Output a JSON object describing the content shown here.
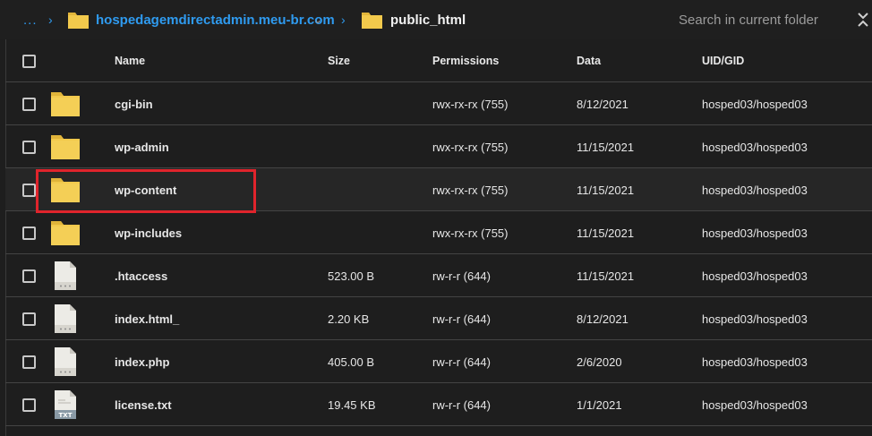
{
  "breadcrumb": {
    "ellipsis": "...",
    "sep": "›",
    "domain": "hospedagemdirectadmin.meu-br.com",
    "domain_caret": "⌄",
    "current": "public_html"
  },
  "search": {
    "placeholder": "Search in current folder"
  },
  "table": {
    "headers": {
      "name": "Name",
      "size": "Size",
      "permissions": "Permissions",
      "data": "Data",
      "uid": "UID/GID"
    },
    "rows": [
      {
        "name": "cgi-bin",
        "size": "",
        "permissions": "rwx-rx-rx (755)",
        "date": "8/12/2021",
        "uid": "hosped03/hosped03",
        "type": "folder"
      },
      {
        "name": "wp-admin",
        "size": "",
        "permissions": "rwx-rx-rx (755)",
        "date": "11/15/2021",
        "uid": "hosped03/hosped03",
        "type": "folder"
      },
      {
        "name": "wp-content",
        "size": "",
        "permissions": "rwx-rx-rx (755)",
        "date": "11/15/2021",
        "uid": "hosped03/hosped03",
        "type": "folder"
      },
      {
        "name": "wp-includes",
        "size": "",
        "permissions": "rwx-rx-rx (755)",
        "date": "11/15/2021",
        "uid": "hosped03/hosped03",
        "type": "folder"
      },
      {
        "name": ".htaccess",
        "size": "523.00 B",
        "permissions": "rw-r-r (644)",
        "date": "11/15/2021",
        "uid": "hosped03/hosped03",
        "type": "file"
      },
      {
        "name": "index.html_",
        "size": "2.20 KB",
        "permissions": "rw-r-r (644)",
        "date": "8/12/2021",
        "uid": "hosped03/hosped03",
        "type": "file"
      },
      {
        "name": "index.php",
        "size": "405.00 B",
        "permissions": "rw-r-r (644)",
        "date": "2/6/2020",
        "uid": "hosped03/hosped03",
        "type": "file"
      },
      {
        "name": "license.txt",
        "size": "19.45 KB",
        "permissions": "rw-r-r (644)",
        "date": "1/1/2021",
        "uid": "hosped03/hosped03",
        "type": "txt"
      }
    ]
  },
  "icons": {
    "txt_label": "TXT"
  },
  "colors": {
    "accent": "#2f9bf0",
    "folder": "#f2c94c",
    "highlight": "#e0242c"
  }
}
